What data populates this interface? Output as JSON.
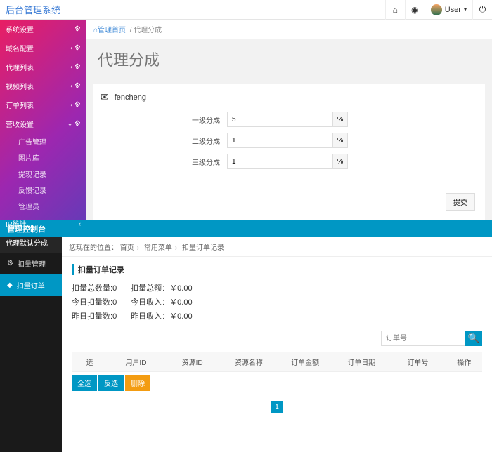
{
  "header": {
    "brand": "后台管理系统",
    "user_label": "User"
  },
  "sidebar1": {
    "items": [
      {
        "label": "系统设置",
        "type": "gear"
      },
      {
        "label": "域名配置",
        "type": "chev-gear"
      },
      {
        "label": "代理列表",
        "type": "chev-gear"
      },
      {
        "label": "视频列表",
        "type": "chev-gear"
      },
      {
        "label": "订单列表",
        "type": "chev-gear"
      },
      {
        "label": "营收设置",
        "type": "chev-gear",
        "expanded": true,
        "children": [
          {
            "label": "广告管理"
          },
          {
            "label": "图片库"
          },
          {
            "label": "提现记录"
          },
          {
            "label": "反馈记录"
          },
          {
            "label": "管理员"
          }
        ]
      },
      {
        "label": "IP统计",
        "type": "chev"
      },
      {
        "label": "代理默认分成",
        "type": "gear"
      }
    ]
  },
  "breadcrumb1": {
    "home": "管理首页",
    "current": "代理分成"
  },
  "page_title": "代理分成",
  "panel1": {
    "name": "fencheng",
    "rows": [
      {
        "label": "一级分成",
        "value": "5"
      },
      {
        "label": "二级分成",
        "value": "1"
      },
      {
        "label": "三级分成",
        "value": "1"
      }
    ],
    "submit": "提交"
  },
  "titlebar2": "管理控制台",
  "sidebar2": {
    "top": "≡",
    "items": [
      {
        "label": "扣量管理",
        "icon": "⚙"
      },
      {
        "label": "扣量订单",
        "icon": "◆",
        "active": true
      }
    ]
  },
  "crumb2": {
    "prefix": "您现在的位置：",
    "parts": [
      "首页",
      "常用菜单",
      "扣量订单记录"
    ]
  },
  "sub_title": "扣量订单记录",
  "stats": {
    "r1a_label": "扣量总数量:",
    "r1a_val": "0",
    "r1b_label": "扣量总额：",
    "r1b_val": "￥0.00",
    "r2a_label": "今日扣量数:",
    "r2a_val": "0",
    "r2b_label": "今日收入：",
    "r2b_val": "￥0.00",
    "r3a_label": "昨日扣量数:",
    "r3a_val": "0",
    "r3b_label": "昨日收入：",
    "r3b_val": "￥0.00"
  },
  "search_placeholder": "订单号",
  "table_headers": [
    "选",
    "用户ID",
    "资源ID",
    "资源名称",
    "订单金额",
    "订单日期",
    "订单号",
    "操作"
  ],
  "action_buttons": {
    "all": "全选",
    "inv": "反选",
    "del": "删除"
  },
  "page_current": "1"
}
